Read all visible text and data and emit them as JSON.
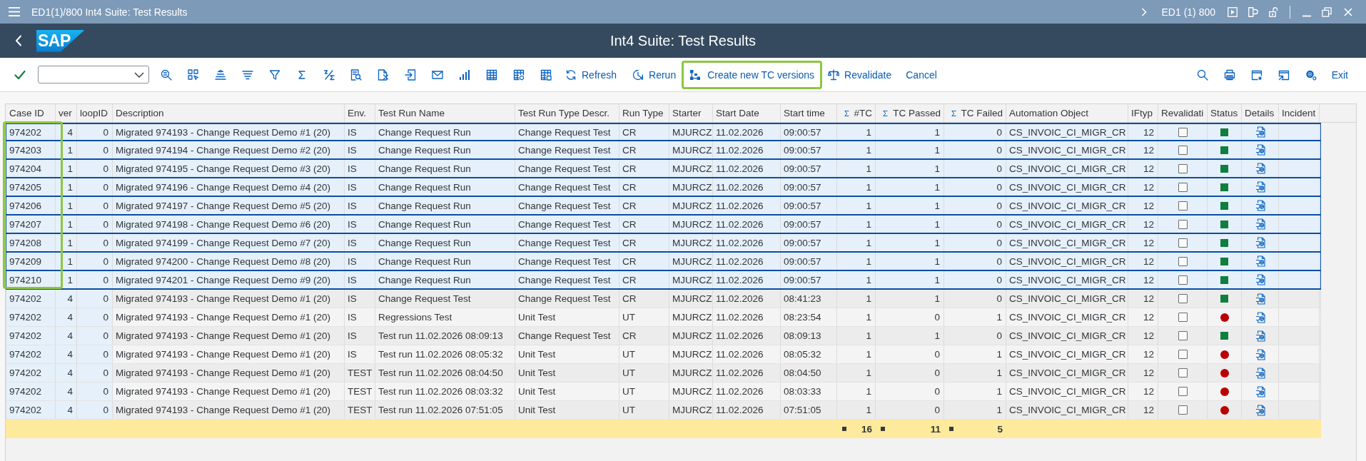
{
  "window": {
    "title": "ED1(1)/800 Int4 Suite: Test Results",
    "system": "ED1 (1) 800"
  },
  "header": {
    "logo": "SAP",
    "title": "Int4 Suite: Test Results"
  },
  "toolbar": {
    "refresh": {
      "label": "Refresh",
      "highlighted": false
    },
    "rerun": {
      "label": "Rerun",
      "highlighted": false
    },
    "create_versions": {
      "label": "Create new TC versions",
      "highlighted": true
    },
    "revalidate": {
      "label": "Revalidate",
      "highlighted": false
    },
    "cancel": {
      "label": "Cancel",
      "highlighted": false
    },
    "exit": {
      "label": "Exit"
    }
  },
  "table": {
    "columns": [
      {
        "label": "Case ID",
        "kind": "text",
        "key": true,
        "summed": false,
        "highlighted": true
      },
      {
        "label": "ver",
        "kind": "number",
        "key": true,
        "summed": false,
        "highlighted": false
      },
      {
        "label": "loopID",
        "kind": "number",
        "key": true,
        "summed": false,
        "highlighted": false
      },
      {
        "label": "Description",
        "kind": "text",
        "key": false,
        "summed": false,
        "highlighted": false
      },
      {
        "label": "Env.",
        "kind": "text",
        "key": false,
        "summed": false,
        "highlighted": false
      },
      {
        "label": "Test Run Name",
        "kind": "text",
        "key": false,
        "summed": false,
        "highlighted": false
      },
      {
        "label": "Test Run Type Descr.",
        "kind": "text",
        "key": false,
        "summed": false,
        "highlighted": false
      },
      {
        "label": "Run Type",
        "kind": "text",
        "key": false,
        "summed": false,
        "highlighted": false
      },
      {
        "label": "Starter",
        "kind": "text",
        "key": false,
        "summed": false,
        "highlighted": false
      },
      {
        "label": "Start Date",
        "kind": "text",
        "key": false,
        "summed": false,
        "highlighted": false
      },
      {
        "label": "Start time",
        "kind": "text",
        "key": false,
        "summed": false,
        "highlighted": false
      },
      {
        "label": "#TC",
        "kind": "number",
        "key": false,
        "summed": true,
        "highlighted": false,
        "total": "16"
      },
      {
        "label": "TC Passed",
        "kind": "number",
        "key": false,
        "summed": true,
        "highlighted": false,
        "total": "11"
      },
      {
        "label": "TC Failed",
        "kind": "number",
        "key": false,
        "summed": true,
        "highlighted": false,
        "total": "5"
      },
      {
        "label": "Automation Object",
        "kind": "text",
        "key": false,
        "summed": false,
        "highlighted": false
      },
      {
        "label": "IFtyp",
        "kind": "number",
        "key": false,
        "summed": false,
        "highlighted": false
      },
      {
        "label": "Revalidati",
        "kind": "checkbox",
        "key": false,
        "summed": false,
        "highlighted": false
      },
      {
        "label": "Status",
        "kind": "status",
        "key": false,
        "summed": false,
        "highlighted": false
      },
      {
        "label": "Details",
        "kind": "details",
        "key": false,
        "summed": false,
        "highlighted": false
      },
      {
        "label": "Incident",
        "kind": "empty",
        "key": false,
        "summed": false,
        "highlighted": false
      }
    ],
    "rows": [
      {
        "selected": true,
        "cells": [
          "974202",
          "4",
          "0",
          "Migrated 974193 - Change Request Demo #1 (20)",
          "IS",
          "Change Request Run",
          "Change Request Test",
          "CR",
          "MJURCZ",
          "11.02.2026",
          "09:00:57",
          "1",
          "1",
          "0",
          "CS_INVOIC_CI_MIGR_CR",
          "12"
        ],
        "revalidate": false,
        "passed": true
      },
      {
        "selected": true,
        "cells": [
          "974203",
          "1",
          "0",
          "Migrated 974194 - Change Request Demo #2 (20)",
          "IS",
          "Change Request Run",
          "Change Request Test",
          "CR",
          "MJURCZ",
          "11.02.2026",
          "09:00:57",
          "1",
          "1",
          "0",
          "CS_INVOIC_CI_MIGR_CR",
          "12"
        ],
        "revalidate": false,
        "passed": true
      },
      {
        "selected": true,
        "cells": [
          "974204",
          "1",
          "0",
          "Migrated 974195 - Change Request Demo #3 (20)",
          "IS",
          "Change Request Run",
          "Change Request Test",
          "CR",
          "MJURCZ",
          "11.02.2026",
          "09:00:57",
          "1",
          "1",
          "0",
          "CS_INVOIC_CI_MIGR_CR",
          "12"
        ],
        "revalidate": false,
        "passed": true
      },
      {
        "selected": true,
        "cells": [
          "974205",
          "1",
          "0",
          "Migrated 974196 - Change Request Demo #4 (20)",
          "IS",
          "Change Request Run",
          "Change Request Test",
          "CR",
          "MJURCZ",
          "11.02.2026",
          "09:00:57",
          "1",
          "1",
          "0",
          "CS_INVOIC_CI_MIGR_CR",
          "12"
        ],
        "revalidate": false,
        "passed": true
      },
      {
        "selected": true,
        "cells": [
          "974206",
          "1",
          "0",
          "Migrated 974197 - Change Request Demo #5 (20)",
          "IS",
          "Change Request Run",
          "Change Request Test",
          "CR",
          "MJURCZ",
          "11.02.2026",
          "09:00:57",
          "1",
          "1",
          "0",
          "CS_INVOIC_CI_MIGR_CR",
          "12"
        ],
        "revalidate": false,
        "passed": true
      },
      {
        "selected": true,
        "cells": [
          "974207",
          "1",
          "0",
          "Migrated 974198 - Change Request Demo #6 (20)",
          "IS",
          "Change Request Run",
          "Change Request Test",
          "CR",
          "MJURCZ",
          "11.02.2026",
          "09:00:57",
          "1",
          "1",
          "0",
          "CS_INVOIC_CI_MIGR_CR",
          "12"
        ],
        "revalidate": false,
        "passed": true
      },
      {
        "selected": true,
        "cells": [
          "974208",
          "1",
          "0",
          "Migrated 974199 - Change Request Demo #7 (20)",
          "IS",
          "Change Request Run",
          "Change Request Test",
          "CR",
          "MJURCZ",
          "11.02.2026",
          "09:00:57",
          "1",
          "1",
          "0",
          "CS_INVOIC_CI_MIGR_CR",
          "12"
        ],
        "revalidate": false,
        "passed": true
      },
      {
        "selected": true,
        "cells": [
          "974209",
          "1",
          "0",
          "Migrated 974200 - Change Request Demo #8 (20)",
          "IS",
          "Change Request Run",
          "Change Request Test",
          "CR",
          "MJURCZ",
          "11.02.2026",
          "09:00:57",
          "1",
          "1",
          "0",
          "CS_INVOIC_CI_MIGR_CR",
          "12"
        ],
        "revalidate": false,
        "passed": true
      },
      {
        "selected": true,
        "cells": [
          "974210",
          "1",
          "0",
          "Migrated 974201 - Change Request Demo #9 (20)",
          "IS",
          "Change Request Run",
          "Change Request Test",
          "CR",
          "MJURCZ",
          "11.02.2026",
          "09:00:57",
          "1",
          "1",
          "0",
          "CS_INVOIC_CI_MIGR_CR",
          "12"
        ],
        "revalidate": false,
        "passed": true
      },
      {
        "selected": false,
        "cells": [
          "974202",
          "4",
          "0",
          "Migrated 974193 - Change Request Demo #1 (20)",
          "IS",
          "Change Request Test",
          "Change Request Test",
          "CR",
          "MJURCZ",
          "11.02.2026",
          "08:41:23",
          "1",
          "1",
          "0",
          "CS_INVOIC_CI_MIGR_CR",
          "12"
        ],
        "revalidate": false,
        "passed": true
      },
      {
        "selected": false,
        "cells": [
          "974202",
          "4",
          "0",
          "Migrated 974193 - Change Request Demo #1 (20)",
          "IS",
          "Regressions Test",
          "Unit Test",
          "UT",
          "MJURCZ",
          "11.02.2026",
          "08:23:54",
          "1",
          "0",
          "1",
          "CS_INVOIC_CI_MIGR_CR",
          "12"
        ],
        "revalidate": false,
        "passed": false
      },
      {
        "selected": false,
        "cells": [
          "974202",
          "4",
          "0",
          "Migrated 974193 - Change Request Demo #1 (20)",
          "IS",
          "Test run 11.02.2026 08:09:13",
          "Change Request Test",
          "CR",
          "MJURCZ",
          "11.02.2026",
          "08:09:13",
          "1",
          "1",
          "0",
          "CS_INVOIC_CI_MIGR_CR",
          "12"
        ],
        "revalidate": false,
        "passed": true
      },
      {
        "selected": false,
        "cells": [
          "974202",
          "4",
          "0",
          "Migrated 974193 - Change Request Demo #1 (20)",
          "IS",
          "Test run 11.02.2026 08:05:32",
          "Unit Test",
          "UT",
          "MJURCZ",
          "11.02.2026",
          "08:05:32",
          "1",
          "0",
          "1",
          "CS_INVOIC_CI_MIGR_CR",
          "12"
        ],
        "revalidate": false,
        "passed": false
      },
      {
        "selected": false,
        "cells": [
          "974202",
          "4",
          "0",
          "Migrated 974193 - Change Request Demo #1 (20)",
          "TEST",
          "Test run 11.02.2026 08:04:50",
          "Unit Test",
          "UT",
          "MJURCZ",
          "11.02.2026",
          "08:04:50",
          "1",
          "0",
          "1",
          "CS_INVOIC_CI_MIGR_CR",
          "12"
        ],
        "revalidate": false,
        "passed": false
      },
      {
        "selected": false,
        "cells": [
          "974202",
          "4",
          "0",
          "Migrated 974193 - Change Request Demo #1 (20)",
          "TEST",
          "Test run 11.02.2026 08:03:32",
          "Unit Test",
          "UT",
          "MJURCZ",
          "11.02.2026",
          "08:03:33",
          "1",
          "0",
          "1",
          "CS_INVOIC_CI_MIGR_CR",
          "12"
        ],
        "revalidate": false,
        "passed": false
      },
      {
        "selected": false,
        "cells": [
          "974202",
          "4",
          "0",
          "Migrated 974193 - Change Request Demo #1 (20)",
          "TEST",
          "Test run 11.02.2026 07:51:05",
          "Unit Test",
          "UT",
          "MJURCZ",
          "11.02.2026",
          "07:51:05",
          "1",
          "0",
          "1",
          "CS_INVOIC_CI_MIGR_CR",
          "12"
        ],
        "revalidate": false,
        "passed": false
      }
    ]
  }
}
